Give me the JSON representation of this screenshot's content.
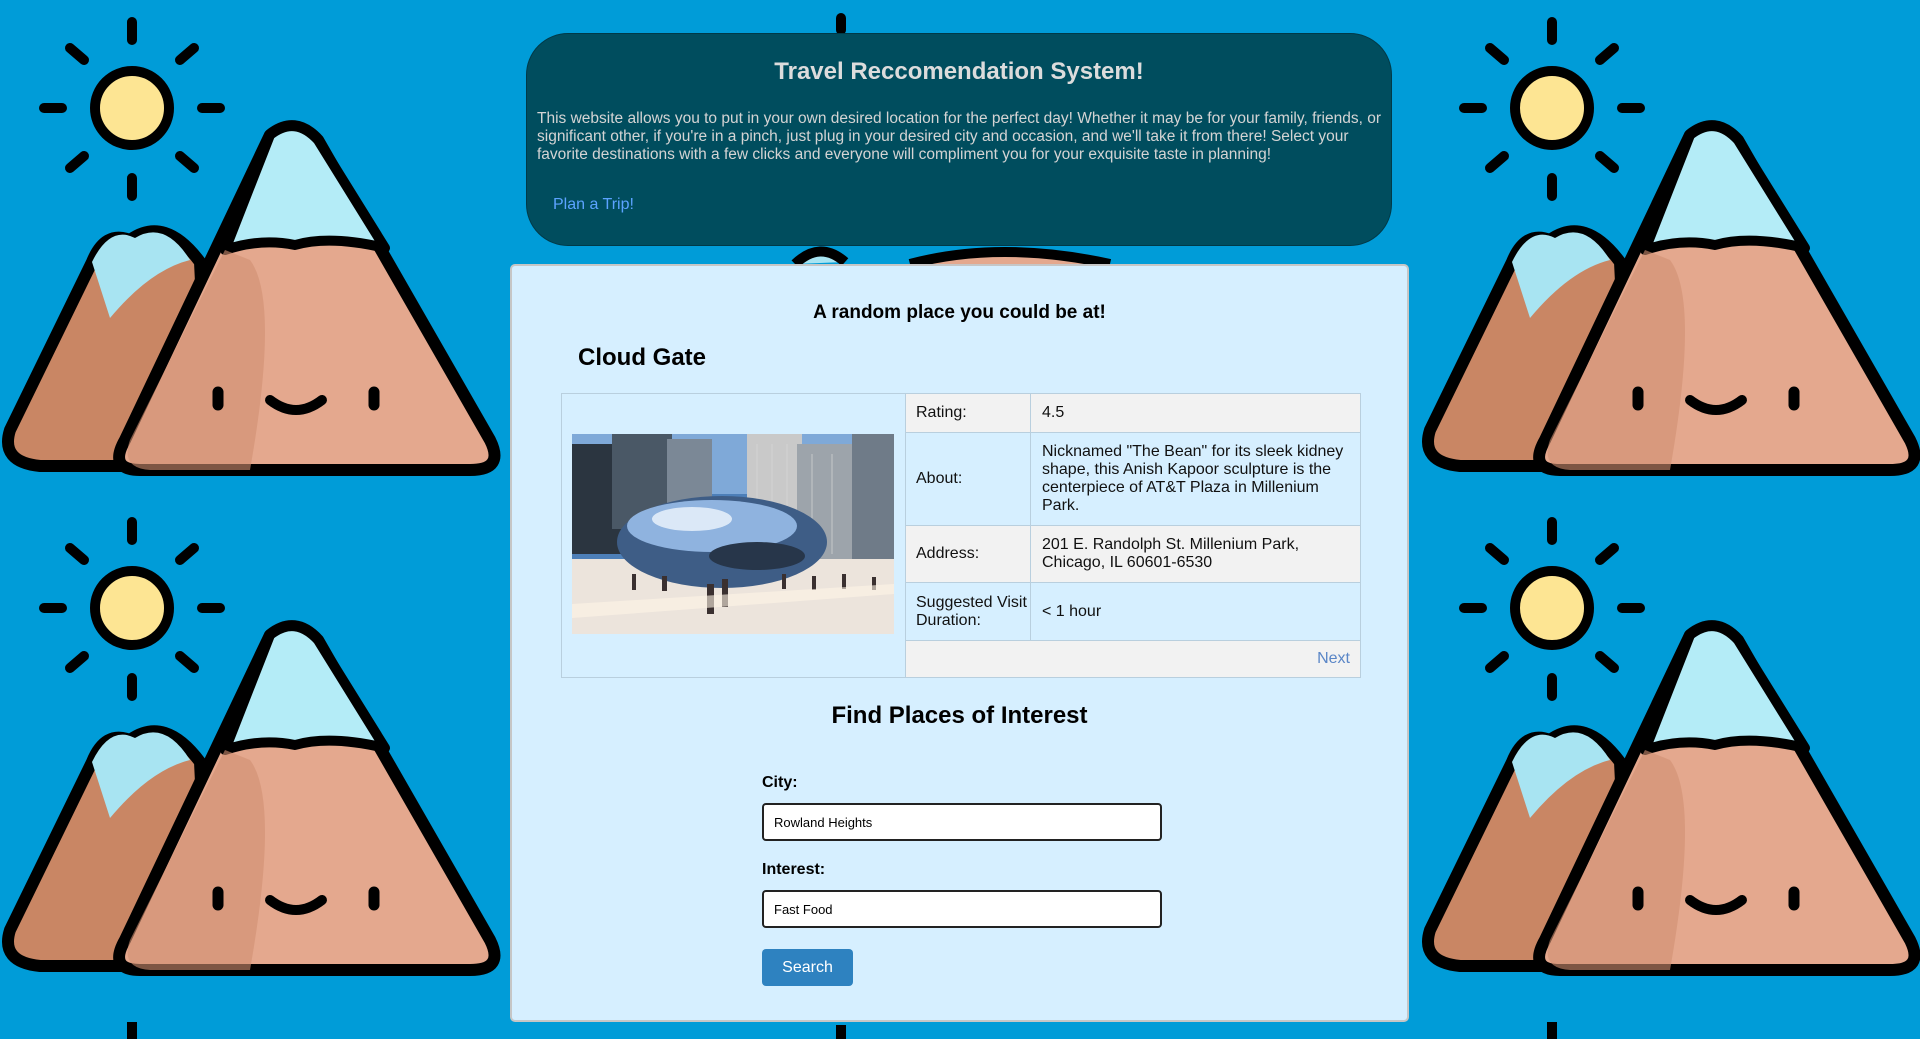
{
  "header": {
    "title": "Travel Reccomendation System!",
    "description": "This website allows you to put in your own desired location for the perfect day! Whether it may be for your family, friends, or significant other, if you're in a pinch, just plug in your desired city and occasion, and we'll take it from there! Select your favorite destinations with a few clicks and everyone will compliment you for your exquisite taste in planning!",
    "plan_link": "Plan a Trip!"
  },
  "random_place": {
    "heading": "A random place you could be at!",
    "name": "Cloud Gate",
    "rating_label": "Rating:",
    "rating_value": "4.5",
    "about_label": "About:",
    "about_value": "Nicknamed \"The Bean\" for its sleek kidney shape, this Anish Kapoor sculpture is the centerpiece of AT&T Plaza in Millenium Park.",
    "address_label": "Address:",
    "address_value": "201 E. Randolph St. Millenium Park, Chicago, IL 60601-6530",
    "duration_label": "Suggested Visit Duration:",
    "duration_value": "< 1 hour",
    "next_link": "Next"
  },
  "search_form": {
    "heading": "Find Places of Interest",
    "city_label": "City:",
    "city_value": "Rowland Heights",
    "interest_label": "Interest:",
    "interest_value": "Fast Food",
    "search_button": "Search"
  },
  "icons": {
    "background": "mountain-sun-pattern-icon",
    "photo": "cloud-gate-photo"
  },
  "colors": {
    "page_background": "#009cd8",
    "header_background": "#004d5e",
    "card_background": "#d6efff",
    "button": "#2e82c0",
    "link": "#5ba3ff"
  }
}
